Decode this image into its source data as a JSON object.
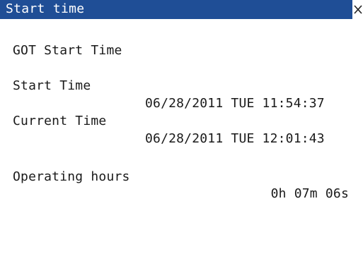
{
  "window": {
    "title": "Start time",
    "close_glyph": "×",
    "title_bar_color": "#1f4e96"
  },
  "content": {
    "heading": "GOT Start Time",
    "start_time_label": "Start Time",
    "start_time_value": "06/28/2011 TUE 11:54:37",
    "current_time_label": "Current Time",
    "current_time_value": "06/28/2011 TUE 12:01:43",
    "operating_hours_label": "Operating hours",
    "operating_hours_value": "0h 07m 06s"
  },
  "icons": {
    "close": "close-icon"
  }
}
